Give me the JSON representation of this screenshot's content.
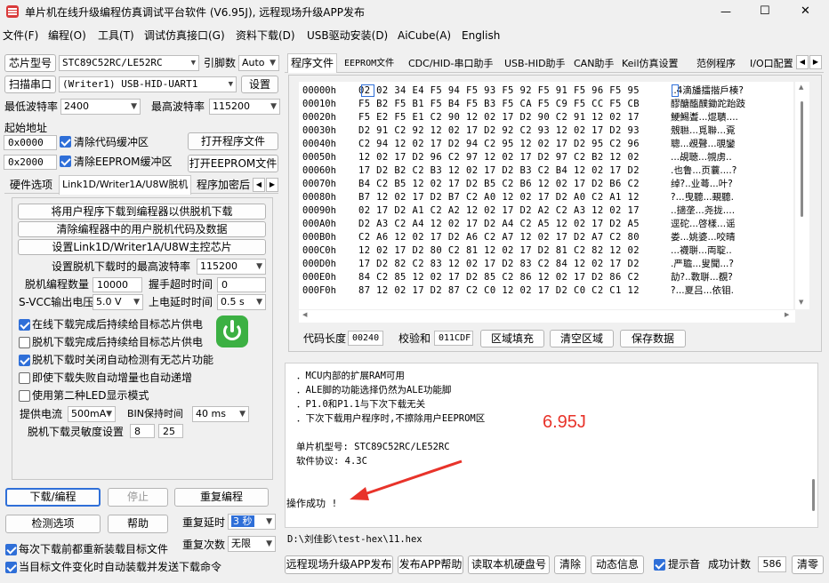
{
  "window": {
    "title": "单片机在线升级编程仿真调试平台软件 (V6.95J), 远程现场升级APP发布",
    "min": "—",
    "max": "☐",
    "close": "✕"
  },
  "menu": [
    "文件(F)",
    "编程(O)",
    "工具(T)",
    "调试仿真接口(G)",
    "资料下载(D)",
    "USB驱动安装(D)",
    "AiCube(A)",
    "English"
  ],
  "left": {
    "chip_btn": "芯片型号",
    "chip_value": "STC89C52RC/LE52RC",
    "pins_label": "引脚数",
    "pins_value": "Auto",
    "scan_btn": "扫描串口",
    "port_value": "(Writer1) USB-HID-UART1",
    "settings_btn": "设置",
    "min_baud_label": "最低波特率",
    "min_baud": "2400",
    "max_baud_label": "最高波特率",
    "max_baud": "115200",
    "start_addr_label": "起始地址",
    "addr1": "0x0000",
    "clear_code": "清除代码缓冲区",
    "open_prog": "打开程序文件",
    "addr2": "0x2000",
    "clear_eeprom": "清除EEPROM缓冲区",
    "open_eeprom": "打开EEPROM文件",
    "tabs": [
      "硬件选项",
      "Link1D/Writer1A/U8W脱机",
      "程序加密后"
    ],
    "offline": {
      "btn1": "将用户程序下载到编程器以供脱机下载",
      "btn2": "清除编程器中的用户脱机代码及数据",
      "btn3": "设置Link1D/Writer1A/U8W主控芯片",
      "max_baud_label": "设置脱机下载时的最高波特率",
      "max_baud": "115200",
      "count_label": "脱机编程数量",
      "count": "10000",
      "timeout_label": "握手超时时间",
      "timeout": "0",
      "svcc_label": "S-VCC输出电压",
      "svcc": "5.0 V",
      "delay_label": "上电延时时间",
      "delay": "0.5 s",
      "opt1": "在线下载完成后持续给目标芯片供电",
      "opt2": "脱机下载完成后持续给目标芯片供电",
      "opt3": "脱机下载时关闭自动检测有无芯片功能",
      "opt4": "即使下载失败自动增量也自动递增",
      "opt5": "使用第二种LED显示模式",
      "current_label": "提供电流",
      "current": "500mA",
      "bin_label": "BIN保持时间",
      "bin": "40 ms",
      "sens_label": "脱机下载灵敏度设置",
      "sens1": "8",
      "sens2": "25"
    },
    "download_btn": "下载/编程",
    "stop_btn": "停止",
    "reprog_btn": "重复编程",
    "detect_btn": "检测选项",
    "help_btn": "帮助",
    "repeat_delay_label": "重复延时",
    "repeat_delay": "3 秒",
    "repeat_count_label": "重复次数",
    "repeat_count": "无限",
    "reload_label": "每次下载前都重新装载目标文件",
    "auto_send_label": "当目标文件变化时自动装载并发送下载命令"
  },
  "right": {
    "tabs": [
      "程序文件",
      "EEPROM文件",
      "CDC/HID-串口助手",
      "USB-HID助手",
      "CAN助手",
      "Keil仿真设置",
      "范例程序",
      "I/O口配置"
    ],
    "hex": [
      {
        "a": "00000h",
        "h": "02 02 34 E4 F5 94 F5 93 F5 92 F5 91 F5 96 F5 95",
        "t": "..4滴旙擂揩戶楱?"
      },
      {
        "a": "00010h",
        "h": "F5 B2 F5 B1 F5 B4 F5 B3 F5 CA F5 C9 F5 CC F5 CB",
        "t": "醪醣醢醭鋤跎跆跂"
      },
      {
        "a": "00020h",
        "h": "F5 E2 F5 E1 C2 90 12 02 17 D2 90 C2 91 12 02 17",
        "t": "鯁鯣聻...焜聵...."
      },
      {
        "a": "00030h",
        "h": "D2 91 C2 92 12 02 17 D2 92 C2 93 12 02 17 D2 93",
        "t": "覫聮...覓聯...覔"
      },
      {
        "a": "00040h",
        "h": "C2 94 12 02 17 D2 94 C2 95 12 02 17 D2 95 C2 96",
        "t": "聰...覕聲...覗鑾"
      },
      {
        "a": "00050h",
        "h": "12 02 17 D2 96 C2 97 12 02 17 D2 97 C2 B2 12 02",
        "t": "...覘聴...覙虏.."
      },
      {
        "a": "00060h",
        "h": "17 D2 B2 C2 B3 12 02 17 D2 B3 C2 B4 12 02 17 D2",
        "t": ".也鲁...页蘘....?"
      },
      {
        "a": "00070h",
        "h": "B4 C2 B5 12 02 17 D2 B5 C2 B6 12 02 17 D2 B6 C2",
        "t": "绰?..业蕚...叶?"
      },
      {
        "a": "00080h",
        "h": "B7 12 02 17 D2 B7 C2 A0 12 02 17 D2 A0 C2 A1 12",
        "t": "?...曳聽...覡聽."
      },
      {
        "a": "00090h",
        "h": "02 17 D2 A1 C2 A2 12 02 17 D2 A2 C2 A3 12 02 17",
        "t": "..擿垄...尧拢...."
      },
      {
        "a": "000A0h",
        "h": "D2 A3 C2 A4 12 02 17 D2 A4 C2 A5 12 02 17 D2 A5",
        "t": "逕砣...啓樣...谣"
      },
      {
        "a": "000B0h",
        "h": "C2 A6 12 02 17 D2 A6 C2 A7 12 02 17 D2 A7 C2 80",
        "t": "娄...姚婆...咬晴"
      },
      {
        "a": "000C0h",
        "h": "12 02 17 D2 80 C2 81 12 02 17 D2 81 C2 82 12 02",
        "t": "...襪聠...両聢.."
      },
      {
        "a": "000D0h",
        "h": "17 D2 82 C2 83 12 02 17 D2 83 C2 84 12 02 17 D2",
        "t": ".严聸...叟聞...?"
      },
      {
        "a": "000E0h",
        "h": "84 C2 85 12 02 17 D2 85 C2 86 12 02 17 D2 86 C2",
        "t": "劼?..斁聠...覩?"
      },
      {
        "a": "000F0h",
        "h": "87 12 02 17 D2 87 C2 C0 12 02 17 D2 C0 C2 C1 12",
        "t": "?...夏吕...依钼."
      }
    ],
    "code_len_label": "代码长度",
    "code_len": "00240",
    "checksum_label": "校验和",
    "checksum": "011CDF",
    "fill_btn": "区域填充",
    "clear_btn": "清空区域",
    "save_btn": "保存数据",
    "messages": [
      "．MCU内部的扩展RAM可用",
      "．ALE脚的功能选择仍然为ALE功能脚",
      "．P1.0和P1.1与下次下载无关",
      "．下次下载用户程序时,不擦除用户EEPROM区",
      "",
      "单片机型号: STC89C52RC/LE52RC",
      "软件协议: 4.3C"
    ],
    "success": "操作成功 !",
    "annotation": "6.95J",
    "file_path": "D:\\刘佳影\\test-hex\\11.hex",
    "bottom": {
      "b1": "远程现场升级APP发布",
      "b2": "发布APP帮助",
      "b3": "读取本机硬盘号",
      "b4": "清除",
      "b5": "动态信息",
      "beep": "提示音",
      "count_label": "成功计数",
      "count": "586",
      "clear": "清零"
    }
  },
  "colors": {
    "accent": "#2f6fd8",
    "annotation": "#e8332a",
    "arrow": "#e8332a",
    "power": "#3cb043"
  }
}
